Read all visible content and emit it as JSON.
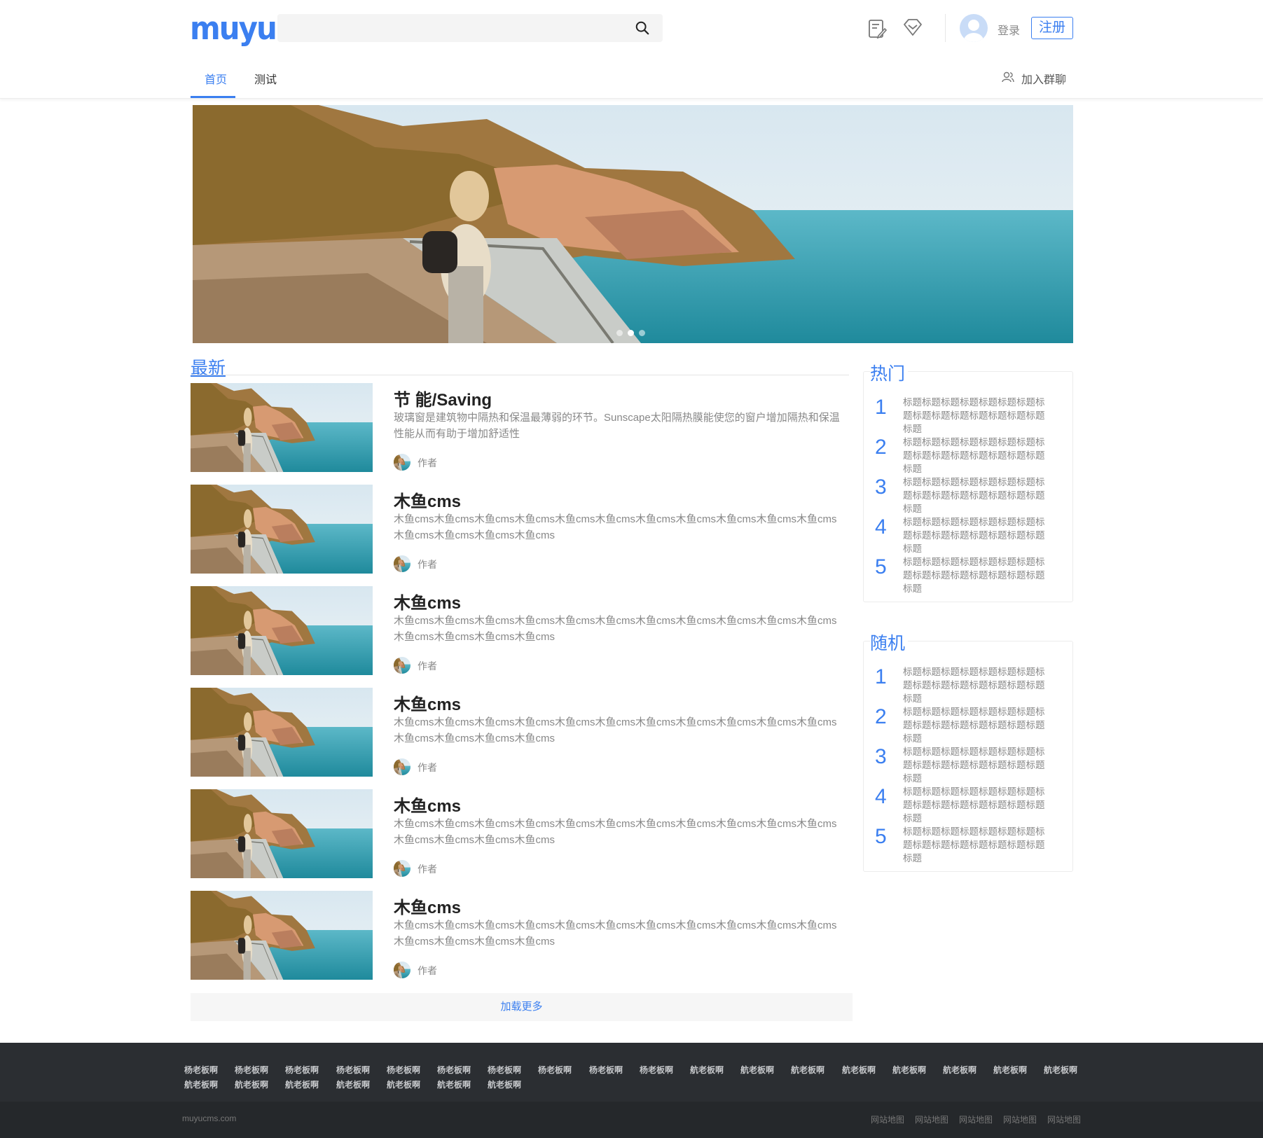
{
  "header": {
    "logo": "muyu",
    "search_placeholder": "",
    "login": "登录",
    "register": "注册",
    "nav": [
      {
        "label": "首页",
        "active": true
      },
      {
        "label": "测试",
        "active": false
      }
    ],
    "join_group": "加入群聊"
  },
  "banner": {
    "image": "coastal-village-cliff-walkway",
    "slides": 3,
    "active_slide": 2
  },
  "latest": {
    "title": "最新",
    "items": [
      {
        "title": "节 能/Saving",
        "desc": "玻璃窗是建筑物中隔热和保温最薄弱的环节。Sunscape太阳隔热膜能使您的窗户增加隔热和保温性能从而有助于增加舒适性",
        "author": "作者"
      },
      {
        "title": "木鱼cms",
        "desc": "木鱼cms木鱼cms木鱼cms木鱼cms木鱼cms木鱼cms木鱼cms木鱼cms木鱼cms木鱼cms木鱼cms木鱼cms木鱼cms木鱼cms木鱼cms",
        "author": "作者"
      },
      {
        "title": "木鱼cms",
        "desc": "木鱼cms木鱼cms木鱼cms木鱼cms木鱼cms木鱼cms木鱼cms木鱼cms木鱼cms木鱼cms木鱼cms木鱼cms木鱼cms木鱼cms木鱼cms",
        "author": "作者"
      },
      {
        "title": "木鱼cms",
        "desc": "木鱼cms木鱼cms木鱼cms木鱼cms木鱼cms木鱼cms木鱼cms木鱼cms木鱼cms木鱼cms木鱼cms木鱼cms木鱼cms木鱼cms木鱼cms",
        "author": "作者"
      },
      {
        "title": "木鱼cms",
        "desc": "木鱼cms木鱼cms木鱼cms木鱼cms木鱼cms木鱼cms木鱼cms木鱼cms木鱼cms木鱼cms木鱼cms木鱼cms木鱼cms木鱼cms木鱼cms",
        "author": "作者"
      },
      {
        "title": "木鱼cms",
        "desc": "木鱼cms木鱼cms木鱼cms木鱼cms木鱼cms木鱼cms木鱼cms木鱼cms木鱼cms木鱼cms木鱼cms木鱼cms木鱼cms木鱼cms木鱼cms",
        "author": "作者"
      }
    ],
    "load_more": "加载更多"
  },
  "hot": {
    "title": "热门",
    "items": [
      {
        "num": "1",
        "text": "标题标题标题标题标题标题标题标题标题标题标题标题标题标题标题标题"
      },
      {
        "num": "2",
        "text": "标题标题标题标题标题标题标题标题标题标题标题标题标题标题标题标题"
      },
      {
        "num": "3",
        "text": "标题标题标题标题标题标题标题标题标题标题标题标题标题标题标题标题"
      },
      {
        "num": "4",
        "text": "标题标题标题标题标题标题标题标题标题标题标题标题标题标题标题标题"
      },
      {
        "num": "5",
        "text": "标题标题标题标题标题标题标题标题标题标题标题标题标题标题标题标题"
      }
    ]
  },
  "random": {
    "title": "随机",
    "items": [
      {
        "num": "1",
        "text": "标题标题标题标题标题标题标题标题标题标题标题标题标题标题标题标题"
      },
      {
        "num": "2",
        "text": "标题标题标题标题标题标题标题标题标题标题标题标题标题标题标题标题"
      },
      {
        "num": "3",
        "text": "标题标题标题标题标题标题标题标题标题标题标题标题标题标题标题标题"
      },
      {
        "num": "4",
        "text": "标题标题标题标题标题标题标题标题标题标题标题标题标题标题标题标题"
      },
      {
        "num": "5",
        "text": "标题标题标题标题标题标题标题标题标题标题标题标题标题标题标题标题"
      }
    ]
  },
  "footer": {
    "links_row1": [
      "杨老板啊",
      "杨老板啊",
      "杨老板啊",
      "杨老板啊",
      "杨老板啊",
      "杨老板啊",
      "杨老板啊",
      "杨老板啊",
      "杨老板啊",
      "杨老板啊",
      "航老板啊",
      "航老板啊",
      "航老板啊",
      "航老板啊",
      "航老板啊",
      "航老板啊",
      "航老板啊",
      "航老板啊"
    ],
    "links_row2": [
      "航老板啊",
      "航老板啊",
      "航老板啊",
      "航老板啊",
      "航老板啊",
      "航老板啊",
      "航老板啊"
    ],
    "copyright": "muyucms.com",
    "sitemap": [
      "网站地图",
      "网站地图",
      "网站地图",
      "网站地图",
      "网站地图"
    ]
  },
  "colors": {
    "accent": "#3b7ff0",
    "footer_top": "#2b2e32",
    "footer_bottom": "#25282b"
  }
}
